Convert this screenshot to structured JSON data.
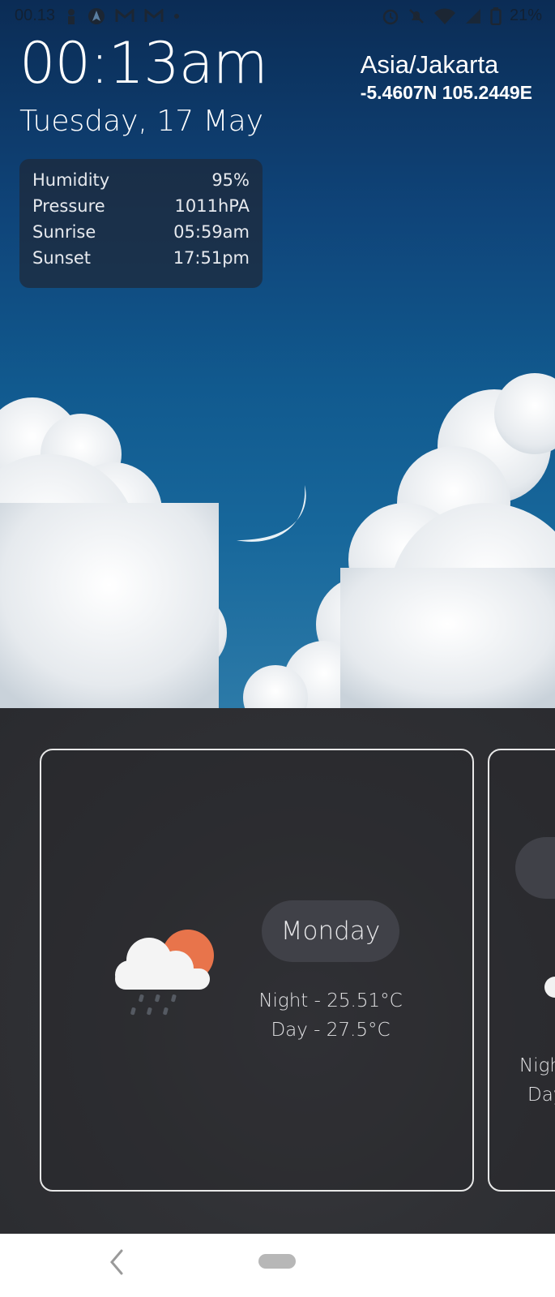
{
  "status_bar": {
    "time": "00.13",
    "battery": "21%",
    "left_icons": [
      "person-icon",
      "navigation-icon",
      "gmail-icon",
      "gmail-icon",
      "dot-icon"
    ],
    "right_icons": [
      "alarm-icon",
      "mute-icon",
      "wifi-icon",
      "signal-icon",
      "battery-icon"
    ]
  },
  "header": {
    "time": "00:13am",
    "date": "Tuesday, 17 May",
    "timezone": "Asia/Jakarta",
    "coordinates": "-5.4607N 105.2449E"
  },
  "details": [
    {
      "label": "Humidity",
      "value": "95%"
    },
    {
      "label": "Pressure",
      "value": "1011hPA"
    },
    {
      "label": "Sunrise",
      "value": "05:59am"
    },
    {
      "label": "Sunset",
      "value": "17:51pm"
    }
  ],
  "forecast": [
    {
      "day": "Monday",
      "night": "Night - 25.51°C",
      "day_temp": "Day - 27.5°C",
      "icon": "cloud-sun-rain-icon"
    },
    {
      "night_partial": "Nigh",
      "day_partial": "Day"
    }
  ],
  "colors": {
    "sun": "#e8744b",
    "panel": "#303135",
    "info_bg": "#1e2837"
  },
  "nav": {
    "icons": [
      "back-icon",
      "home-pill-icon"
    ]
  }
}
